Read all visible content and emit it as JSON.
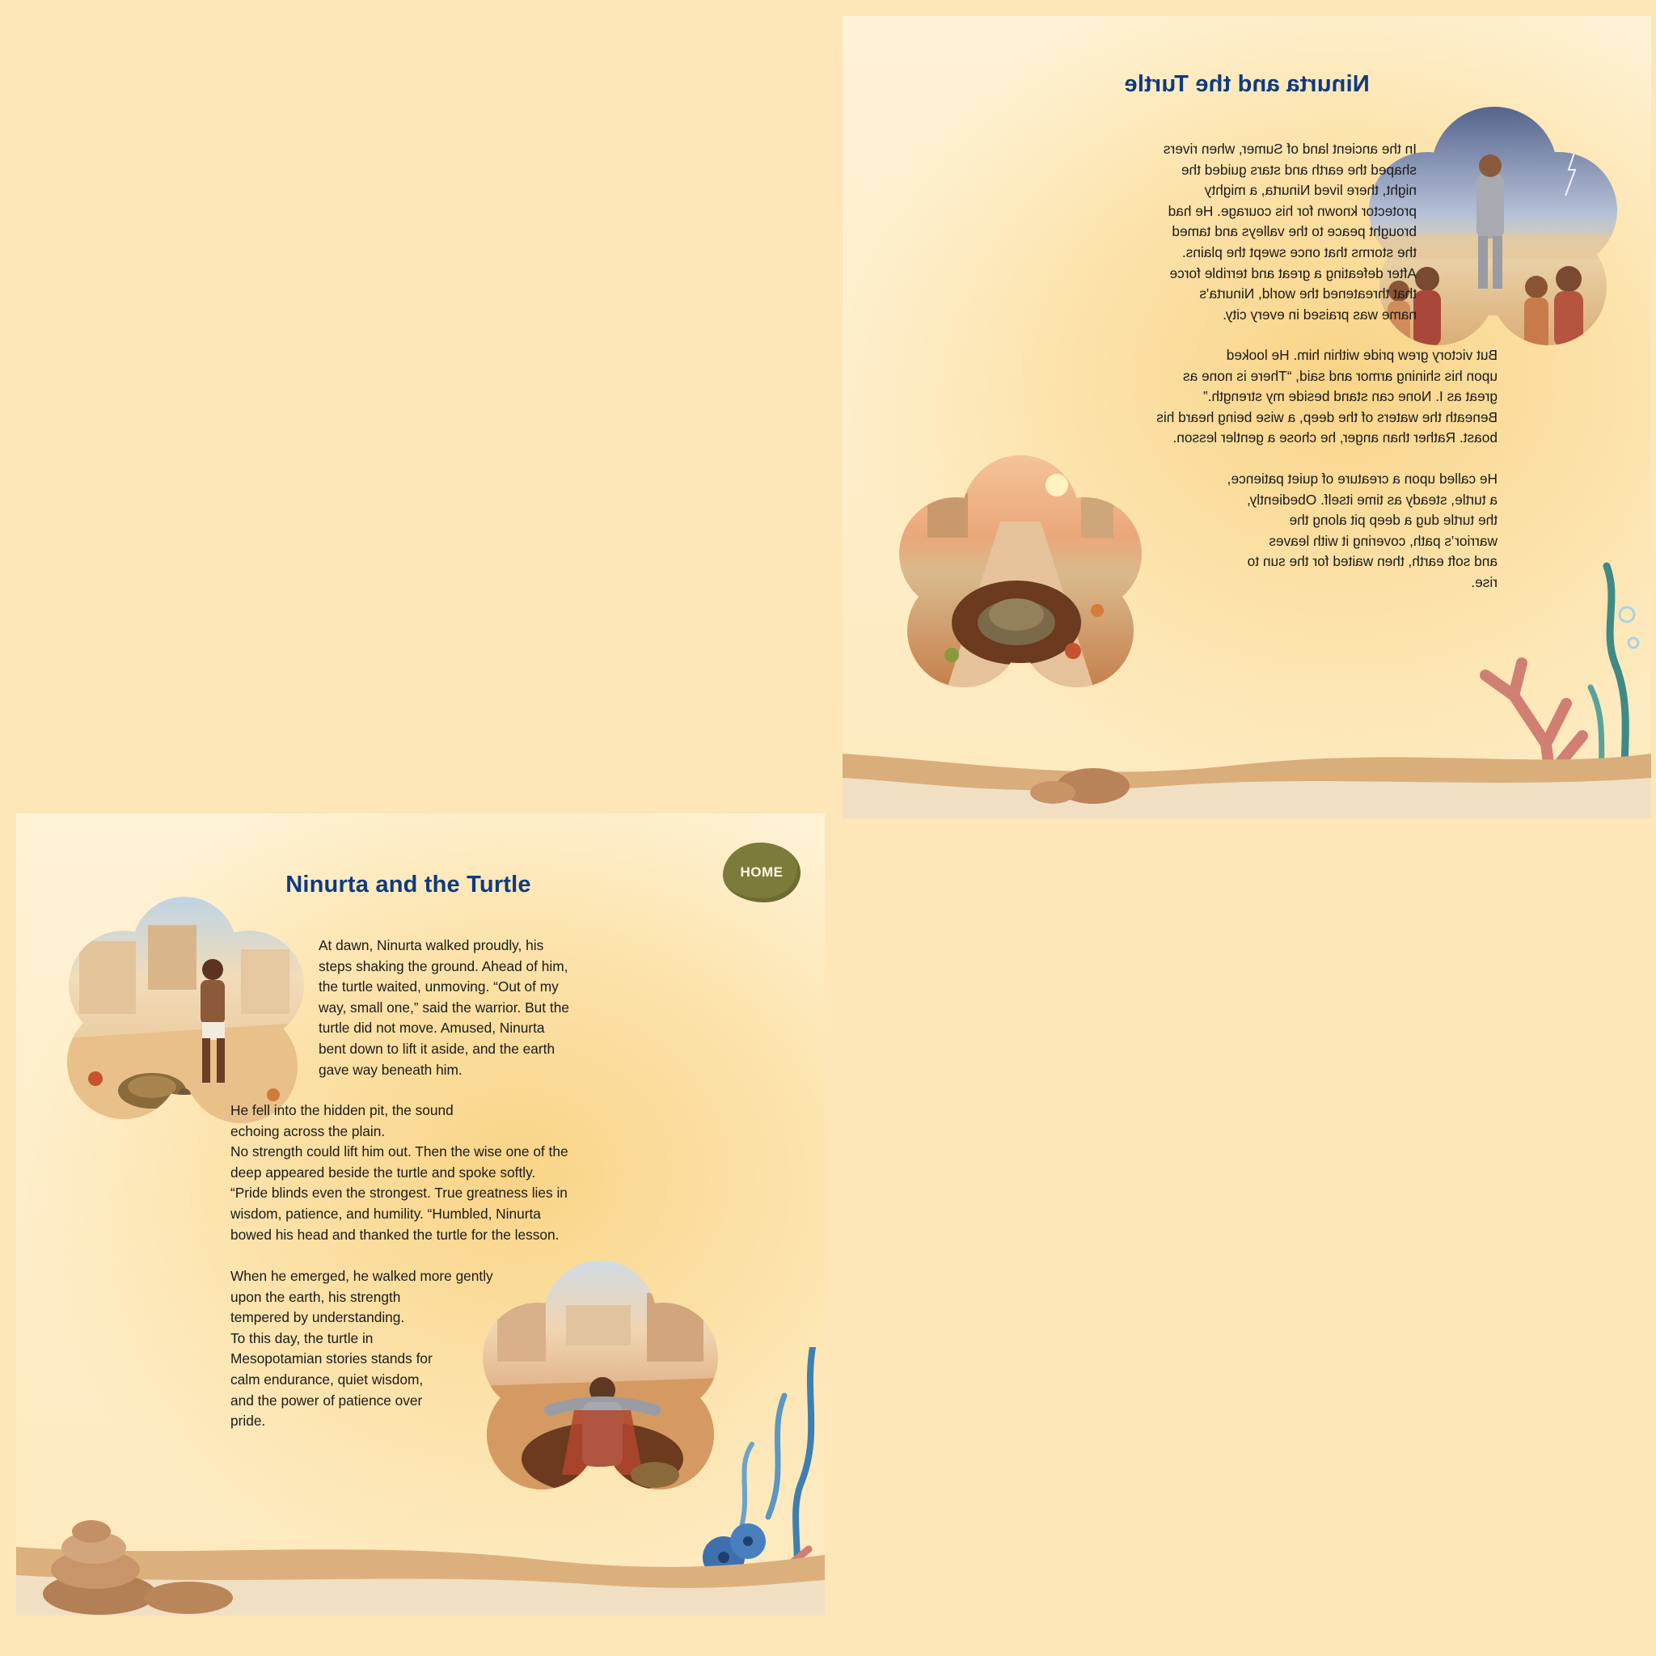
{
  "pages": [
    {
      "mirrored": true,
      "title": "Ninurta and the Turtle",
      "paragraphs": [
        "In the ancient land of Sumer, when rivers\nshaped the earth and stars guided the\nnight, there lived Ninurta, a mighty\nprotector known for his courage. He had\nbrought peace to the valleys and tamed\nthe storms that once swept the plains.\nAfter defeating a great and terrible force\nthat threatened the world, Ninurta’s\nname was praised in every city.",
        "But victory grew pride within him. He looked\nupon his shining armor and said, “There is none as\ngreat as I. None can stand beside my strength.”\nBeneath the waters of the deep, a wise being heard his\nboast. Rather than anger, he chose a gentler lesson.",
        "He called upon a creature of quiet patience,\na turtle, steady as time itself. Obediently,\nthe turtle dug a deep pit along the\nwarrior’s path, covering it with leaves\nand soft earth, then waited for the sun to\nrise."
      ]
    },
    {
      "mirrored": false,
      "title": "Ninurta and the Turtle",
      "home_label": "HOME",
      "paragraphs": [
        "At dawn, Ninurta walked proudly, his\nsteps shaking the ground. Ahead of him,\nthe turtle waited, unmoving. “Out of my\nway, small one,” said the warrior. But the\nturtle did not move. Amused, Ninurta\nbent down to lift it aside, and the earth\ngave way beneath him.",
        "He fell into the hidden pit, the sound\nechoing across the plain.\nNo strength could lift him out. Then the wise one of the\ndeep appeared beside the turtle and spoke softly.\n“Pride blinds even the strongest. True greatness lies in\nwisdom, patience, and humility. “Humbled, Ninurta\nbowed his head and thanked the turtle for the lesson.",
        "When he emerged, he walked more gently\nupon the earth, his strength\ntempered by understanding.\nTo this day, the turtle in\nMesopotamian stories stands for\ncalm endurance, quiet wisdom,\nand the power of patience over\npride."
      ]
    }
  ],
  "illustrations": [
    "ninurta-before-crowd-storm",
    "turtle-in-pit-on-road",
    "ninurta-approaching-turtle",
    "ninurta-fallen-in-pit"
  ],
  "colors": {
    "background": "#fde6b8",
    "title": "#103a80",
    "text": "#1b1b1b",
    "home_button": "#7d7b3a"
  }
}
